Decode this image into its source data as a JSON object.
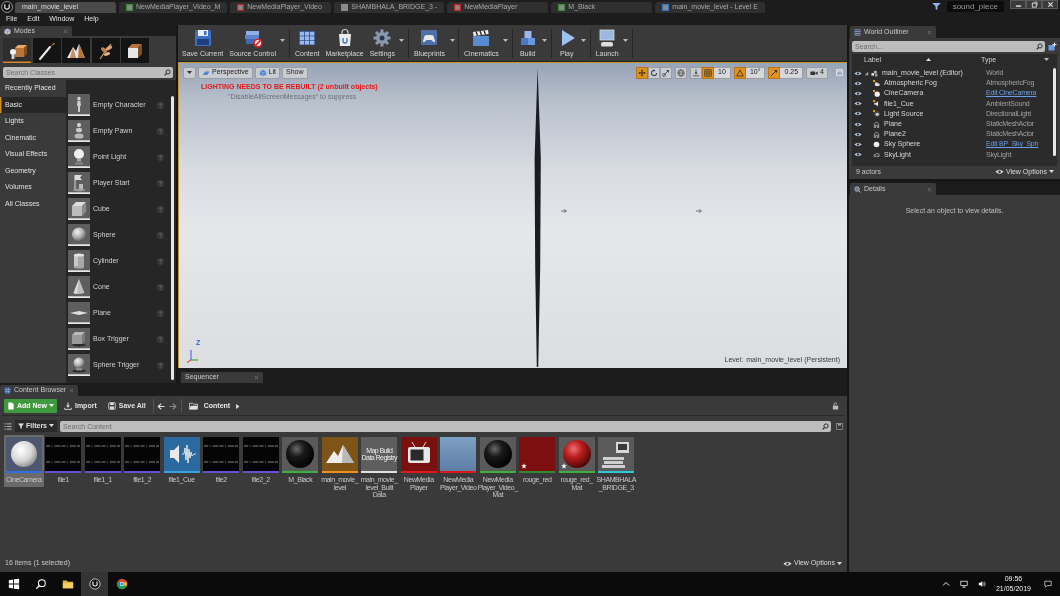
{
  "window": {
    "tabs": [
      {
        "label": "main_movie_level",
        "selected": true
      },
      {
        "label": "NewMediaPlayer_Video_M",
        "selected": false,
        "color": "#3c8c3c"
      },
      {
        "label": "NewMediaPlayer_Video",
        "selected": false,
        "color": "#c02424"
      },
      {
        "label": "SHAMBHALA_BRIDGE_3 -",
        "selected": false,
        "color": "#8c8c8c"
      },
      {
        "label": "NewMediaPlayer",
        "selected": false,
        "color": "#c02424"
      },
      {
        "label": "M_Black",
        "selected": false,
        "color": "#3c8c3c"
      },
      {
        "label": "main_movie_level - Level E",
        "selected": false,
        "color": "#3a78c0"
      }
    ],
    "project": "sound_piece"
  },
  "menu": [
    "File",
    "Edit",
    "Window",
    "Help"
  ],
  "modes": {
    "title": "Modes",
    "tools": [
      {
        "kind": "place",
        "selected": true
      },
      {
        "kind": "paint",
        "selected": false
      },
      {
        "kind": "landscape",
        "selected": false
      },
      {
        "kind": "foliage",
        "selected": false
      },
      {
        "kind": "geometry",
        "selected": false
      }
    ],
    "search": {
      "placeholder": "Search Classes"
    },
    "categories": [
      {
        "label": "Recently Placed",
        "selected": false
      },
      {
        "label": "Basic",
        "selected": true
      },
      {
        "label": "Lights",
        "selected": false
      },
      {
        "label": "Cinematic",
        "selected": false
      },
      {
        "label": "Visual Effects",
        "selected": false
      },
      {
        "label": "Geometry",
        "selected": false
      },
      {
        "label": "Volumes",
        "selected": false
      },
      {
        "label": "All Classes",
        "selected": false
      }
    ],
    "items": [
      {
        "label": "Empty Character",
        "kind": "figure"
      },
      {
        "label": "Empty Pawn",
        "kind": "pawn"
      },
      {
        "label": "Point Light",
        "kind": "bulb"
      },
      {
        "label": "Player Start",
        "kind": "flag"
      },
      {
        "label": "Cube",
        "kind": "cube"
      },
      {
        "label": "Sphere",
        "kind": "sphere"
      },
      {
        "label": "Cylinder",
        "kind": "cylinder"
      },
      {
        "label": "Cone",
        "kind": "cone"
      },
      {
        "label": "Plane",
        "kind": "plane"
      },
      {
        "label": "Box Trigger",
        "kind": "box"
      },
      {
        "label": "Sphere Trigger",
        "kind": "sphere_trigger"
      }
    ]
  },
  "toolbar": {
    "buttons": [
      {
        "label": "Save Current",
        "kind": "save",
        "dropdown": false
      },
      {
        "label": "Source Control",
        "kind": "source_control",
        "dropdown": true
      },
      {
        "label": "Content",
        "kind": "content",
        "dropdown": false
      },
      {
        "label": "Marketplace",
        "kind": "marketplace",
        "dropdown": false
      },
      {
        "label": "Settings",
        "kind": "settings",
        "dropdown": true
      },
      {
        "label": "Blueprints",
        "kind": "blueprints",
        "dropdown": true
      },
      {
        "label": "Cinematics",
        "kind": "cinematics",
        "dropdown": true
      },
      {
        "label": "Build",
        "kind": "build",
        "dropdown": true
      },
      {
        "label": "Play",
        "kind": "play",
        "dropdown": true
      },
      {
        "label": "Launch",
        "kind": "launch",
        "dropdown": true
      }
    ]
  },
  "viewport": {
    "view_buttons": [
      {
        "label": "Perspective",
        "kind": "perspective"
      },
      {
        "label": "Lit",
        "kind": "lit"
      },
      {
        "label": "Show",
        "kind": "plain"
      }
    ],
    "transform_tools": [
      {
        "kind": "translate",
        "selected": true
      },
      {
        "kind": "rotate",
        "selected": false
      },
      {
        "kind": "scale",
        "selected": false
      }
    ],
    "snaps": [
      {
        "kind": "grid",
        "on": true,
        "value": "10"
      },
      {
        "kind": "rotation",
        "on": true,
        "value": "10°"
      },
      {
        "kind": "scale",
        "on": true,
        "value": "0.25"
      }
    ],
    "camera_speed": "4",
    "warning": "LIGHTING NEEDS TO BE REBUILT (2 unbuilt objects)",
    "hint": "\"DisableAllScreenMessages\" to suppress",
    "axis_label": "Z",
    "level_label": "Level:",
    "level_name": "main_movie_level (Persistent)"
  },
  "sequencer": {
    "title": "Sequencer"
  },
  "world_outliner": {
    "title": "World Outliner",
    "search": {
      "placeholder": "Search..."
    },
    "columns": [
      "Label",
      "Type"
    ],
    "tree": [
      {
        "label": "main_movie_level (Editor)",
        "type": "World",
        "kind": "world",
        "type_link": false,
        "expanded": true,
        "children": [
          {
            "label": "Atmospheric Fog",
            "type": "AtmosphericFog",
            "kind": "fog",
            "type_link": false
          },
          {
            "label": "CineCamera",
            "type": "Edit CineCamera",
            "kind": "camera",
            "type_link": true
          },
          {
            "label": "file1_Cue",
            "type": "AmbientSound",
            "kind": "sound",
            "type_link": false
          },
          {
            "label": "Light Source",
            "type": "DirectionalLight",
            "kind": "light",
            "type_link": false
          },
          {
            "label": "Plane",
            "type": "StaticMeshActor",
            "kind": "mesh",
            "type_link": false
          },
          {
            "label": "Plane2",
            "type": "StaticMeshActor",
            "kind": "mesh",
            "type_link": false
          },
          {
            "label": "Sky Sphere",
            "type": "Edit BP_Sky_Sph",
            "kind": "sphere",
            "type_link": true
          },
          {
            "label": "SkyLight",
            "type": "SkyLight",
            "kind": "skylight",
            "type_link": false
          }
        ]
      }
    ],
    "count": "9 actors",
    "view_options": "View Options"
  },
  "details": {
    "title": "Details",
    "message": "Select an object to view details."
  },
  "content_browser": {
    "title": "Content Browser",
    "add_new": "Add New",
    "buttons": [
      {
        "label": "Import",
        "kind": "import"
      },
      {
        "label": "Save All",
        "kind": "save_all"
      }
    ],
    "path": "Content",
    "filters": "Filters",
    "search": {
      "placeholder": "Search Content"
    },
    "assets": [
      {
        "label": "CineCamera",
        "kind": "sphere_white",
        "color": "#2f6fe0",
        "selected": true,
        "modified": false
      },
      {
        "label": "file1",
        "kind": "wave",
        "color": "#6b4fd0",
        "selected": false,
        "modified": false
      },
      {
        "label": "file1_1",
        "kind": "wave",
        "color": "#6b4fd0",
        "selected": false,
        "modified": false
      },
      {
        "label": "file1_2",
        "kind": "wave",
        "color": "#6b4fd0",
        "selected": false,
        "modified": false
      },
      {
        "label": "file1_Cue",
        "kind": "sound",
        "color": "#39a0e0",
        "selected": false,
        "modified": false
      },
      {
        "label": "file2",
        "kind": "wave",
        "color": "#6b4fd0",
        "selected": false,
        "modified": false
      },
      {
        "label": "file2_2",
        "kind": "wave",
        "color": "#6b4fd0",
        "selected": false,
        "modified": false
      },
      {
        "label": "M_Black",
        "kind": "sphere_black",
        "color": "#3fb03f",
        "selected": false,
        "modified": false
      },
      {
        "label": "main_movie_\nlevel",
        "kind": "level",
        "color": "#f0901c",
        "selected": false,
        "modified": false
      },
      {
        "label": "main_movie_\nlevel_Built\nData",
        "kind": "registry",
        "color": "#e0e0e0",
        "selected": false,
        "modified": false,
        "thumbnail_text": "Map Build\nData Registry"
      },
      {
        "label": "NewMedia\nPlayer",
        "kind": "tv",
        "color": "#e01818",
        "selected": false,
        "modified": false
      },
      {
        "label": "NewMedia\nPlayer_Video",
        "kind": "photo",
        "color": "#e01818",
        "selected": false,
        "modified": false
      },
      {
        "label": "NewMedia\nPlayer_Video_\nMat",
        "kind": "sphere_black",
        "color": "#3fb03f",
        "selected": false,
        "modified": false
      },
      {
        "label": "rouge_red",
        "kind": "swatch",
        "color": "#2f8a2f",
        "selected": false,
        "modified": true
      },
      {
        "label": "rouge_red_\nMat",
        "kind": "sphere_red",
        "color": "#3fb03f",
        "selected": false,
        "modified": true
      },
      {
        "label": "SHAMBHALA\n_BRIDGE_3",
        "kind": "mesh",
        "color": "#2fc8d8",
        "selected": false,
        "modified": false
      }
    ],
    "status": "16 items (1 selected)",
    "view_options": "View Options"
  },
  "taskbar": {
    "apps": [
      {
        "kind": "start",
        "active": false
      },
      {
        "kind": "search",
        "active": false
      },
      {
        "kind": "explorer",
        "active": false
      },
      {
        "kind": "unreal",
        "active": true
      },
      {
        "kind": "chrome",
        "active": false
      }
    ],
    "time": "09:56",
    "date": "21/05/2019"
  }
}
